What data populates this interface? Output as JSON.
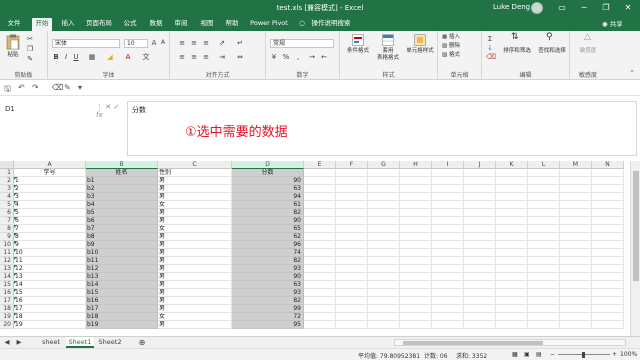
{
  "window": {
    "title": "test.xls  [兼容模式]  -  Excel",
    "user": "Luke Deng",
    "controls": [
      "▭",
      "─",
      "❐",
      "✕"
    ]
  },
  "ribbon_tabs": [
    "文件",
    "开始",
    "插入",
    "页面布局",
    "公式",
    "数据",
    "审阅",
    "视图",
    "帮助",
    "Power Pivot",
    "操作说明搜索"
  ],
  "active_tab": "开始",
  "share_label": "共享",
  "ribbon": {
    "clipboard": {
      "paste": "粘贴",
      "label": "剪贴板"
    },
    "font": {
      "name": "宋体",
      "size": "10",
      "label": "字体"
    },
    "alignment": {
      "label": "对齐方式"
    },
    "number": {
      "format": "常规",
      "label": "数字"
    },
    "styles": {
      "cond_format": "条件格式",
      "table_format": "套用\n表格格式",
      "cell_style": "单元格样式",
      "label": "样式"
    },
    "cells": {
      "insert": "插入",
      "delete": "删除",
      "format": "格式",
      "label": "单元格"
    },
    "editing": {
      "sort_filter": "排序和筛选",
      "find_select": "查找和选择",
      "label": "编辑"
    },
    "sensitivity": {
      "button": "敏感度",
      "label": "敏感度"
    }
  },
  "formula_bar": {
    "name_box": "D1",
    "fx": "fx",
    "content": "分数"
  },
  "annotation": "①选中需要的数据",
  "columns": [
    "A",
    "B",
    "C",
    "D",
    "E",
    "F",
    "G",
    "H",
    "I",
    "J",
    "K",
    "L",
    "M",
    "N"
  ],
  "selected_columns": [
    "B",
    "D"
  ],
  "headers_row": {
    "a": "学号",
    "b": "姓名",
    "c": "性别",
    "d": "分数"
  },
  "rows": [
    {
      "n": "2",
      "a": "1",
      "b": "b1",
      "c": "男",
      "d": "90"
    },
    {
      "n": "3",
      "a": "2",
      "b": "b2",
      "c": "男",
      "d": "63"
    },
    {
      "n": "4",
      "a": "3",
      "b": "b3",
      "c": "男",
      "d": "94"
    },
    {
      "n": "5",
      "a": "4",
      "b": "b4",
      "c": "女",
      "d": "61"
    },
    {
      "n": "6",
      "a": "5",
      "b": "b5",
      "c": "男",
      "d": "82"
    },
    {
      "n": "7",
      "a": "6",
      "b": "b6",
      "c": "男",
      "d": "90"
    },
    {
      "n": "8",
      "a": "7",
      "b": "b7",
      "c": "女",
      "d": "65"
    },
    {
      "n": "9",
      "a": "8",
      "b": "b8",
      "c": "男",
      "d": "62"
    },
    {
      "n": "10",
      "a": "9",
      "b": "b9",
      "c": "男",
      "d": "96"
    },
    {
      "n": "11",
      "a": "10",
      "b": "b10",
      "c": "男",
      "d": "74"
    },
    {
      "n": "12",
      "a": "11",
      "b": "b11",
      "c": "男",
      "d": "82"
    },
    {
      "n": "13",
      "a": "12",
      "b": "b12",
      "c": "男",
      "d": "93"
    },
    {
      "n": "14",
      "a": "13",
      "b": "b13",
      "c": "男",
      "d": "90"
    },
    {
      "n": "15",
      "a": "14",
      "b": "b14",
      "c": "男",
      "d": "63"
    },
    {
      "n": "16",
      "a": "15",
      "b": "b15",
      "c": "男",
      "d": "93"
    },
    {
      "n": "17",
      "a": "16",
      "b": "b16",
      "c": "男",
      "d": "82"
    },
    {
      "n": "18",
      "a": "17",
      "b": "b17",
      "c": "男",
      "d": "99"
    },
    {
      "n": "19",
      "a": "18",
      "b": "b18",
      "c": "女",
      "d": "72"
    },
    {
      "n": "20",
      "a": "19",
      "b": "b19",
      "c": "男",
      "d": "95"
    }
  ],
  "sheet_tabs": [
    "sheet",
    "Sheet1",
    "Sheet2"
  ],
  "active_sheet": "Sheet1",
  "status": {
    "average": "平均值: 79.80952381",
    "count": "计数: 06",
    "sum": "求和: 3352",
    "zoom": "100%"
  },
  "colors": {
    "accent": "#217346",
    "annotation": "#e81123",
    "selection": "#cfcfcf"
  }
}
